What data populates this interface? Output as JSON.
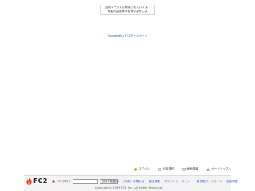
{
  "notice": {
    "line1": "当該ページ又は削除されています。",
    "line2": "掲載内容は関する問いませんよ"
  },
  "powered": {
    "text": "Powered by FC2ホームページ"
  },
  "footer": {
    "icons": [
      {
        "label": "ログイン",
        "icon": "login-icon",
        "color": "#d9a300"
      },
      {
        "label": "利用規約",
        "icon": "document-icon",
        "color": "#7a8fb8"
      },
      {
        "label": "画面情報",
        "icon": "screen-icon",
        "color": "#4a70c0"
      },
      {
        "label": "ページトップへ",
        "icon": "arrow-up-icon",
        "color": "#c0303a"
      }
    ],
    "logo": "FC2",
    "search_label": "FC2ブログ",
    "search_button": "ブログ検索",
    "links": [
      "サポート利用・お問い合",
      "会社概要",
      "プライバシーポリシー",
      "著作権ガイドライン",
      "広告掲載"
    ],
    "copyright": "Copyright(c)1999 FC2, Inc. All Rights Reserved."
  }
}
